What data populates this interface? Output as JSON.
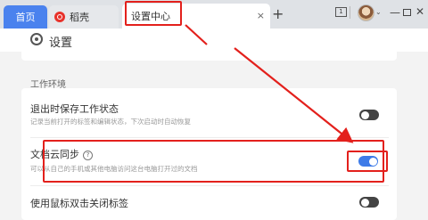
{
  "tabs": {
    "home": "首页",
    "draft": "稻壳",
    "settings": "设置中心",
    "close": "×",
    "add": "+"
  },
  "window": {
    "box_icon_text": "1",
    "minimize": "—",
    "close": "✕",
    "chevron": "⌄"
  },
  "page": {
    "title": "设置",
    "section_title": "工作环境"
  },
  "settings": [
    {
      "title": "退出时保存工作状态",
      "desc": "记录当前打开的标签和编辑状态，下次启动时自动恢复",
      "enabled": false
    },
    {
      "title": "文档云同步",
      "help": "?",
      "desc": "可以从自己的手机或其他电脑访问这台电脑打开过的文档",
      "enabled": true
    },
    {
      "title": "使用鼠标双击关闭标签",
      "enabled": false
    }
  ],
  "colors": {
    "accent": "#3d7be8",
    "highlight": "#e3201c",
    "home_tab": "#4a82ee"
  }
}
